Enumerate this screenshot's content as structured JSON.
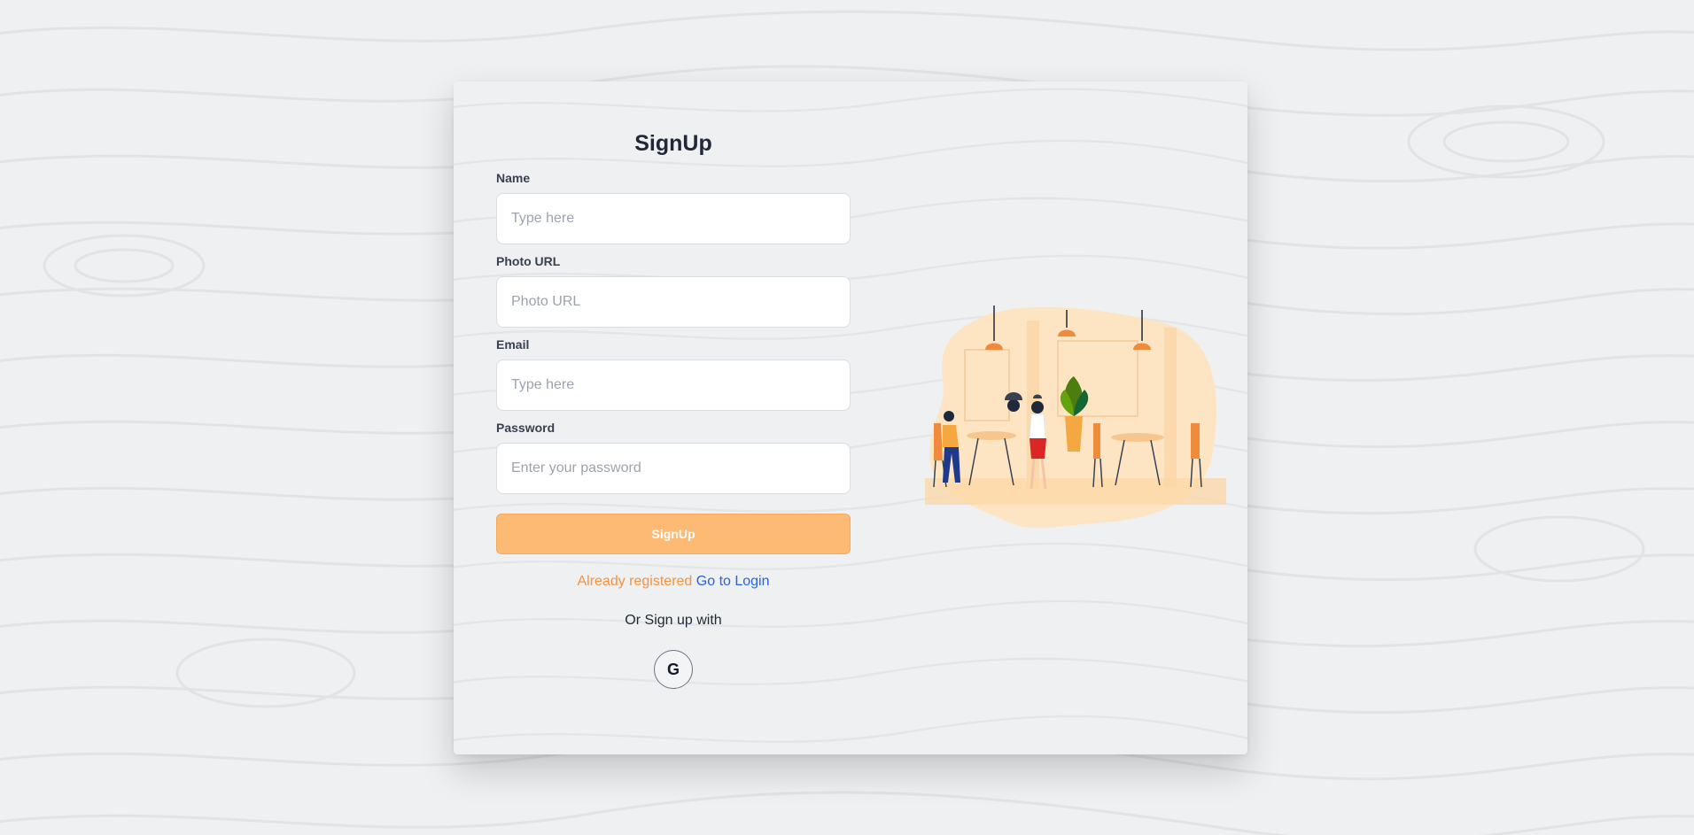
{
  "form": {
    "title": "SignUp",
    "name": {
      "label": "Name",
      "placeholder": "Type here"
    },
    "photo": {
      "label": "Photo URL",
      "placeholder": "Photo URL"
    },
    "email": {
      "label": "Email",
      "placeholder": "Type here"
    },
    "password": {
      "label": "Password",
      "placeholder": "Enter your password"
    },
    "submit_label": "SignUp",
    "already_text": "Already registered",
    "login_link": "Go to Login",
    "or_text": "Or Sign up with",
    "google_glyph": "G"
  },
  "icons": {
    "social": "google-icon"
  },
  "colors": {
    "accent": "#fdba74",
    "already_text": "#f5923e",
    "link": "#2563eb",
    "background": "#eff0f2"
  }
}
